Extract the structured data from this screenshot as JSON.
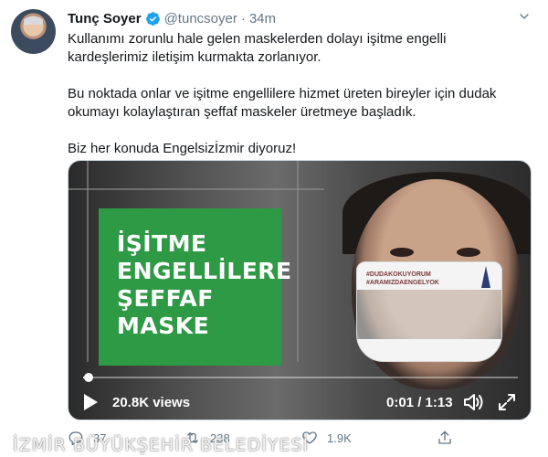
{
  "author": {
    "name": "Tunç Soyer",
    "handle": "@tuncsoyer",
    "separator": "·",
    "time": "34m",
    "verified": true
  },
  "tweet": {
    "paragraphs": [
      {
        "line1": "Kullanımı zorunlu hale gelen maskelerden dolayı işitme engelli",
        "line2": "kardeşlerimiz iletişim kurmakta zorlanıyor."
      },
      {
        "line1": "Bu noktada onlar ve işitme engellilere hizmet üreten bireyler için dudak",
        "line2": "okumayı kolaylaştıran şeffaf maskeler üretmeye başladık."
      },
      {
        "line1": "Biz her konuda Engelsizİzmir diyoruz!"
      }
    ]
  },
  "video": {
    "overlay_lines": [
      "İŞİTME",
      "ENGELLİLERE",
      "ŞEFFAF",
      "MASKE"
    ],
    "mask_lines": [
      "#DUDAKOKUYORUM",
      "#ARAMIZDAENGELYOK"
    ],
    "views": "20.8K views",
    "duration": "0:01 / 1:13",
    "progress": 0.013,
    "colors": {
      "overlay_green": "#2f9a46",
      "control_white": "#ffffff"
    }
  },
  "actions": {
    "reply_count": "37",
    "retweet_count": "238",
    "like_count": "1.9K",
    "icons": [
      "reply-icon",
      "retweet-icon",
      "like-icon",
      "share-icon"
    ]
  },
  "watermark": "İZMİR BÜYÜKŞEHİR BELEDİYESİ",
  "theme": {
    "text_primary": "#14171a",
    "text_secondary": "#657786",
    "verified_blue": "#1da1f2"
  }
}
